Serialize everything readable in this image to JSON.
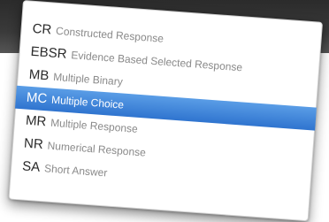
{
  "dropdown": {
    "selected_index": 3,
    "options": [
      {
        "code": "CR",
        "label": "Constructed Response"
      },
      {
        "code": "EBSR",
        "label": "Evidence Based Selected Response"
      },
      {
        "code": "MB",
        "label": "Multiple Binary"
      },
      {
        "code": "MC",
        "label": "Multiple Choice"
      },
      {
        "code": "MR",
        "label": "Multiple Response"
      },
      {
        "code": "NR",
        "label": "Numerical Response"
      },
      {
        "code": "SA",
        "label": "Short Answer"
      }
    ]
  },
  "colors": {
    "selected_bg": "#3a80d8",
    "backdrop": "#2b2b2b"
  }
}
